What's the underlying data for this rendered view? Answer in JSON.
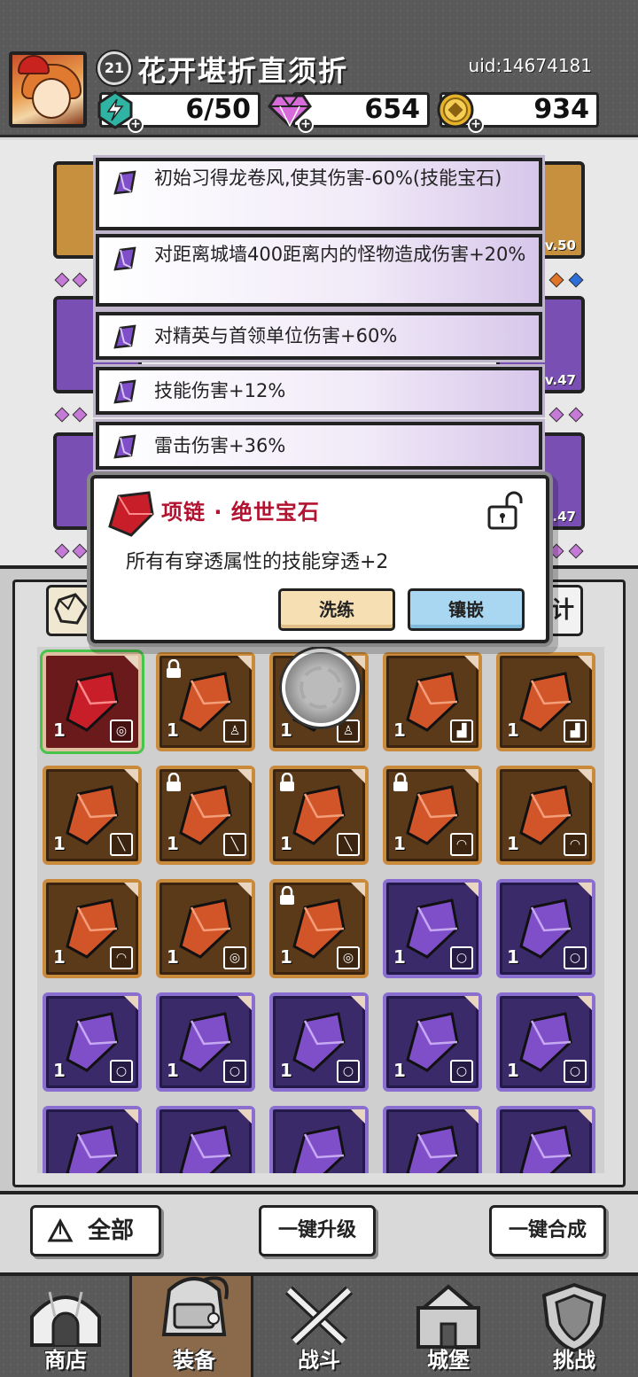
{
  "player": {
    "level": "21",
    "name": "花开堪折直须折",
    "uid": "uid:14674181"
  },
  "resources": {
    "energy": "6/50",
    "gems": "654",
    "gold": "934"
  },
  "equipment_slots": [
    {
      "level": "v.50"
    },
    {
      "level": "v.47"
    },
    {
      "level": ".47"
    }
  ],
  "affixes": [
    {
      "text": "初始习得龙卷风,使其伤害-60%(技能宝石)"
    },
    {
      "text": "对距离城墙400距离内的怪物造成伤害+20%"
    },
    {
      "text": "对精英与首领单位伤害+60%"
    },
    {
      "text": "技能伤害+12%"
    },
    {
      "text": "雷击伤害+36%"
    }
  ],
  "gem_popup": {
    "title": "项链 · 绝世宝石",
    "description": "所有有穿透属性的技能穿透+2",
    "refine_label": "洗练",
    "inlay_label": "镶嵌"
  },
  "inventory": {
    "right_tab_glyph": "计",
    "items": [
      {
        "rarity": "red",
        "count": "1",
        "slot": "necklace",
        "locked": false,
        "selected": true
      },
      {
        "rarity": "orange",
        "count": "1",
        "slot": "armor",
        "locked": true
      },
      {
        "rarity": "orange",
        "count": "1",
        "slot": "armor",
        "locked": false
      },
      {
        "rarity": "orange",
        "count": "1",
        "slot": "boots",
        "locked": false
      },
      {
        "rarity": "orange",
        "count": "1",
        "slot": "boots",
        "locked": false
      },
      {
        "rarity": "orange",
        "count": "1",
        "slot": "weapon",
        "locked": false
      },
      {
        "rarity": "orange",
        "count": "1",
        "slot": "weapon",
        "locked": true
      },
      {
        "rarity": "orange",
        "count": "1",
        "slot": "weapon",
        "locked": true
      },
      {
        "rarity": "orange",
        "count": "1",
        "slot": "helmet",
        "locked": true
      },
      {
        "rarity": "orange",
        "count": "1",
        "slot": "helmet",
        "locked": false
      },
      {
        "rarity": "orange",
        "count": "1",
        "slot": "helmet",
        "locked": false
      },
      {
        "rarity": "orange",
        "count": "1",
        "slot": "necklace",
        "locked": false
      },
      {
        "rarity": "orange",
        "count": "1",
        "slot": "necklace",
        "locked": true
      },
      {
        "rarity": "purple",
        "count": "1",
        "slot": "ring",
        "locked": false
      },
      {
        "rarity": "purple",
        "count": "1",
        "slot": "ring",
        "locked": false
      },
      {
        "rarity": "purple",
        "count": "1",
        "slot": "ring",
        "locked": false
      },
      {
        "rarity": "purple",
        "count": "1",
        "slot": "ring",
        "locked": false
      },
      {
        "rarity": "purple",
        "count": "1",
        "slot": "ring",
        "locked": false
      },
      {
        "rarity": "purple",
        "count": "1",
        "slot": "ring",
        "locked": false
      },
      {
        "rarity": "purple",
        "count": "1",
        "slot": "ring",
        "locked": false
      },
      {
        "rarity": "purple",
        "count": "1",
        "slot": "ring",
        "locked": false
      },
      {
        "rarity": "purple",
        "count": "1",
        "slot": "ring",
        "locked": false
      },
      {
        "rarity": "purple",
        "count": "1",
        "slot": "ring",
        "locked": false
      },
      {
        "rarity": "purple",
        "count": "1",
        "slot": "ring",
        "locked": false
      },
      {
        "rarity": "purple",
        "count": "1",
        "slot": "ring",
        "locked": false
      }
    ]
  },
  "actions": {
    "all": "全部",
    "upgrade_all": "一键升级",
    "combine_all": "一键合成"
  },
  "nav": [
    {
      "label": "商店",
      "icon": "shop-icon"
    },
    {
      "label": "装备",
      "icon": "backpack-icon",
      "active": true
    },
    {
      "label": "战斗",
      "icon": "crossed-swords-icon"
    },
    {
      "label": "城堡",
      "icon": "castle-icon"
    },
    {
      "label": "挑战",
      "icon": "shield-icon"
    }
  ],
  "colors": {
    "orange_frame": "#c98a3b",
    "purple_frame": "#8a6fd0",
    "red_gem": "#c81e2a",
    "popup_title": "#b21330",
    "selected_outline": "#47c44a"
  }
}
